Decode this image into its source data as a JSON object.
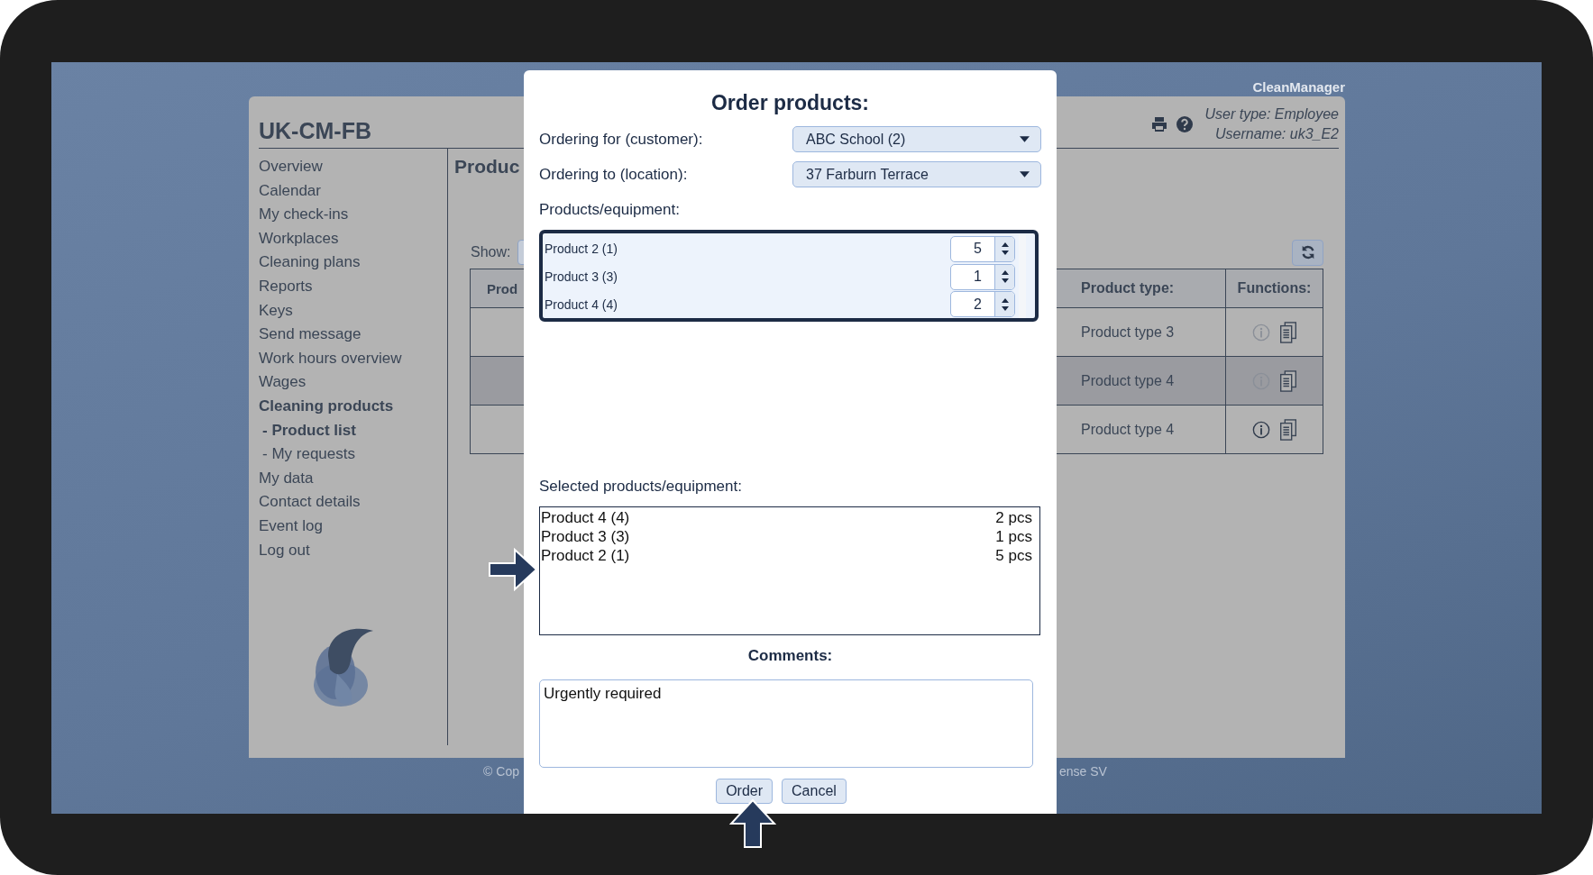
{
  "brand": "CleanManager",
  "app": {
    "title": "UK-CM-FB",
    "user_type": "User type: Employee",
    "username": "Username: uk3_E2"
  },
  "sidebar": {
    "items": [
      {
        "label": "Overview",
        "selected": false
      },
      {
        "label": "Calendar",
        "selected": false
      },
      {
        "label": "My check-ins",
        "selected": false
      },
      {
        "label": "Workplaces",
        "selected": false
      },
      {
        "label": "Cleaning plans",
        "selected": false
      },
      {
        "label": "Reports",
        "selected": false
      },
      {
        "label": "Keys",
        "selected": false
      },
      {
        "label": "Send message",
        "selected": false
      },
      {
        "label": "Work hours overview",
        "selected": false
      },
      {
        "label": "Wages",
        "selected": false
      },
      {
        "label": "Cleaning products",
        "selected": true,
        "children": [
          {
            "label": "- Product list",
            "selected": true
          },
          {
            "label": "- My requests",
            "selected": false
          }
        ]
      },
      {
        "label": "My data",
        "selected": false
      },
      {
        "label": "Contact details",
        "selected": false
      },
      {
        "label": "Event log",
        "selected": false
      },
      {
        "label": "Log out",
        "selected": false
      }
    ]
  },
  "content": {
    "heading": "Produc",
    "show_label": "Show:",
    "table": {
      "columns": [
        "Prod",
        "Product type:",
        "Functions:"
      ],
      "rows": [
        {
          "product_type": "Product type 3",
          "highlighted": false,
          "info_enabled": false
        },
        {
          "product_type": "Product type 4",
          "highlighted": true,
          "info_enabled": false
        },
        {
          "product_type": "Product type 4",
          "highlighted": false,
          "info_enabled": true
        }
      ]
    }
  },
  "footer": {
    "left": "© Cop",
    "right": "ense SV"
  },
  "dialog": {
    "title": "Order products:",
    "fields": [
      {
        "label": "Ordering for (customer):",
        "value": "ABC School (2)"
      },
      {
        "label": "Ordering to (location):",
        "value": "37 Farburn Terrace"
      }
    ],
    "products_label": "Products/equipment:",
    "products": [
      {
        "name": "Product 2 (1)",
        "quantity": "5"
      },
      {
        "name": "Product 3 (3)",
        "quantity": "1"
      },
      {
        "name": "Product 4 (4)",
        "quantity": "2"
      }
    ],
    "selected_label": "Selected products/equipment:",
    "selected": [
      {
        "name": "Product 4 (4)",
        "quantity": "2 pcs"
      },
      {
        "name": "Product 3 (3)",
        "quantity": "1 pcs"
      },
      {
        "name": "Product 2 (1)",
        "quantity": "5 pcs"
      }
    ],
    "comments_label": "Comments:",
    "comments": "Urgently required",
    "buttons": [
      "Order",
      "Cancel"
    ]
  }
}
